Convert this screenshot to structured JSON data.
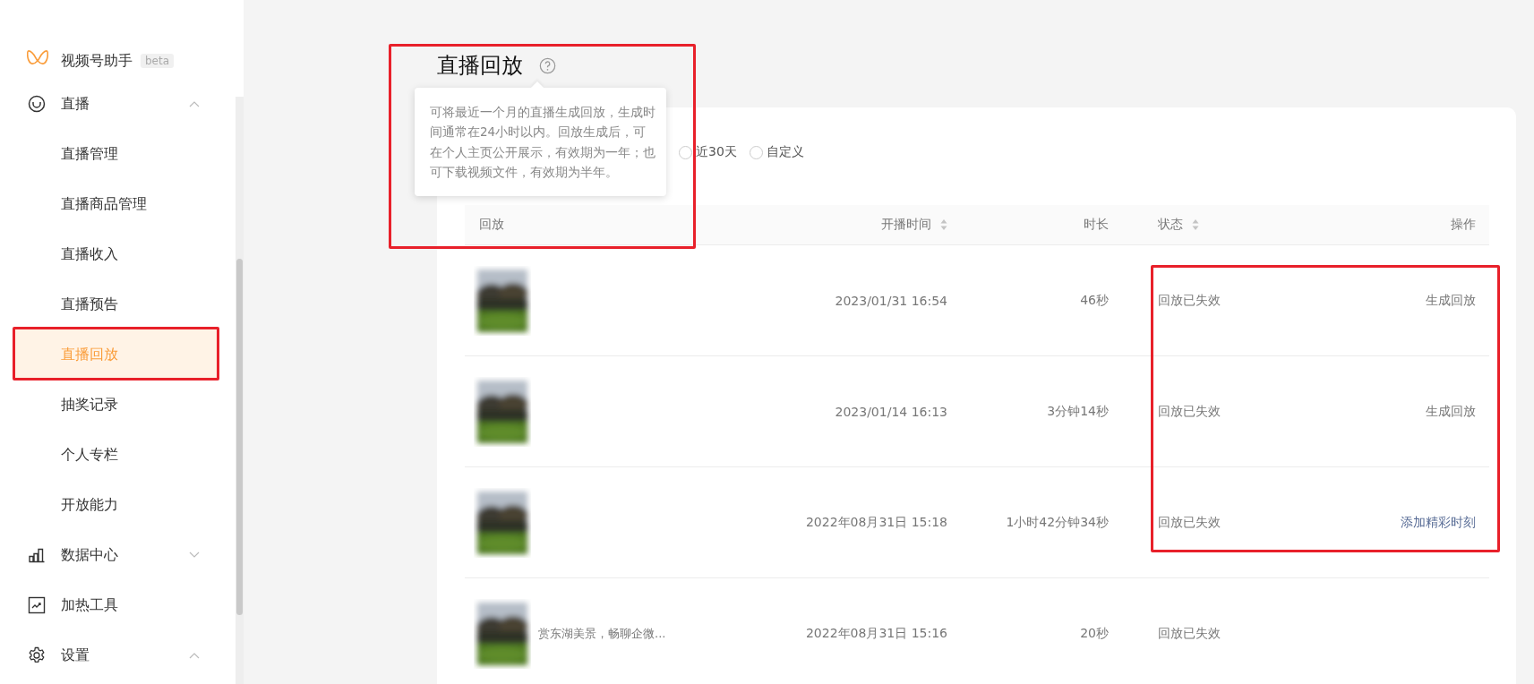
{
  "sidebar": {
    "brand": {
      "name": "视频号助手",
      "badge": "beta"
    },
    "nav": [
      {
        "label": "直播",
        "expanded": true,
        "children": [
          {
            "label": "直播管理",
            "selected": false
          },
          {
            "label": "直播商品管理",
            "selected": false
          },
          {
            "label": "直播收入",
            "selected": false
          },
          {
            "label": "直播预告",
            "selected": false
          },
          {
            "label": "直播回放",
            "selected": true
          },
          {
            "label": "抽奖记录",
            "selected": false
          },
          {
            "label": "个人专栏",
            "selected": false
          },
          {
            "label": "开放能力",
            "selected": false
          }
        ]
      },
      {
        "label": "数据中心",
        "expanded": false
      },
      {
        "label": "加热工具"
      },
      {
        "label": "设置",
        "expanded": true
      }
    ]
  },
  "page": {
    "title": "直播回放",
    "help_tooltip": "可将最近一个月的直播生成回放，生成时间通常在24小时以内。回放生成后，可在个人主页公开展示，有效期为一年；也可下载视频文件，有效期为半年。"
  },
  "filter": {
    "options": [
      {
        "label": "近30天",
        "selected": false
      },
      {
        "label": "自定义",
        "selected": false
      }
    ]
  },
  "table": {
    "columns": [
      {
        "label": "回放",
        "sortable": false
      },
      {
        "label": "开播时间",
        "sortable": true
      },
      {
        "label": "时长",
        "sortable": false
      },
      {
        "label": "状态",
        "sortable": true
      },
      {
        "label": "操作",
        "sortable": false
      }
    ],
    "rows": [
      {
        "start_time": "2023/01/31 16:54",
        "duration": "46秒",
        "status": "回放已失效",
        "action": {
          "kind": "muted",
          "label": "生成回放"
        }
      },
      {
        "start_time": "2023/01/14 16:13",
        "duration": "3分钟14秒",
        "status": "回放已失效",
        "action": {
          "kind": "muted",
          "label": "生成回放"
        }
      },
      {
        "start_time": "2022年08月31日 15:18",
        "duration": "1小时42分钟34秒",
        "status": "回放已失效",
        "action": {
          "kind": "link",
          "label": "添加精彩时刻"
        }
      },
      {
        "title": "赏东湖美景，畅聊企微...",
        "start_time": "2022年08月31日 15:16",
        "duration": "20秒",
        "status": "回放已失效"
      }
    ]
  },
  "annotation_frames": [
    {
      "kind": "frame"
    },
    {
      "kind": "frame"
    },
    {
      "kind": "frame"
    }
  ]
}
